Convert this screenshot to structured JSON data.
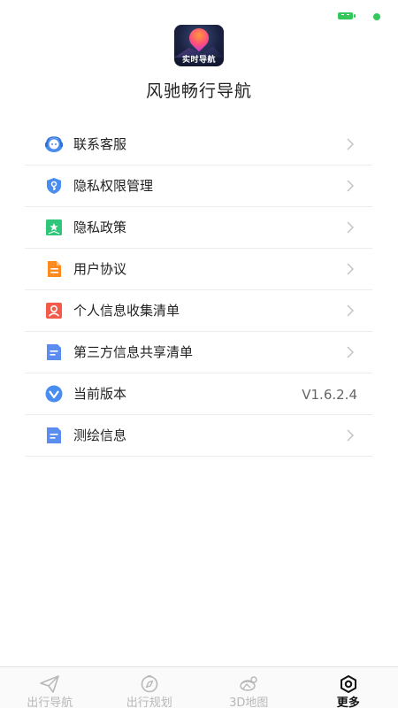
{
  "app": {
    "logo_text": "实时导航",
    "name": "风驰畅行导航"
  },
  "menu": {
    "items": [
      {
        "label": "联系客服",
        "icon": "customer-service-icon"
      },
      {
        "label": "隐私权限管理",
        "icon": "shield-key-icon"
      },
      {
        "label": "隐私政策",
        "icon": "bookmark-star-icon"
      },
      {
        "label": "用户协议",
        "icon": "document-icon"
      },
      {
        "label": "个人信息收集清单",
        "icon": "person-card-icon"
      },
      {
        "label": "第三方信息共享清单",
        "icon": "list-doc-icon"
      },
      {
        "label": "当前版本",
        "icon": "version-icon",
        "value": "V1.6.2.4"
      },
      {
        "label": "测绘信息",
        "icon": "list-doc-icon"
      }
    ]
  },
  "tabs": [
    {
      "label": "出行导航",
      "icon": "paper-plane-icon",
      "active": false
    },
    {
      "label": "出行规划",
      "icon": "compass-icon",
      "active": false
    },
    {
      "label": "3D地图",
      "icon": "globe-route-icon",
      "active": false
    },
    {
      "label": "更多",
      "icon": "hexagon-settings-icon",
      "active": true
    }
  ],
  "colors": {
    "accent": "#4a8df0",
    "active_tab": "#111111",
    "inactive_tab": "#b8b8b8",
    "status_green": "#34c759"
  }
}
